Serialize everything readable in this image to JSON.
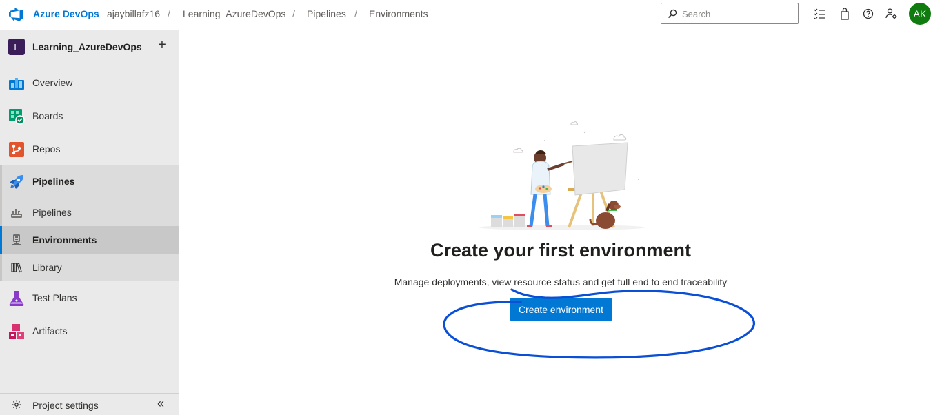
{
  "header": {
    "brand": "Azure DevOps",
    "org": "ajaybillafz16",
    "breadcrumb": [
      "Learning_AzureDevOps",
      "Pipelines",
      "Environments"
    ],
    "separator": "/",
    "search_placeholder": "Search",
    "avatar_initials": "AK",
    "avatar_color": "#107c10",
    "icons": [
      "task-list-icon",
      "shopping-bag-icon",
      "help-icon",
      "user-settings-icon"
    ]
  },
  "sidebar": {
    "project_initial": "L",
    "project_name": "Learning_AzureDevOps",
    "add_label": "+",
    "items": [
      {
        "label": "Overview",
        "icon": "overview-icon"
      },
      {
        "label": "Boards",
        "icon": "boards-icon"
      },
      {
        "label": "Repos",
        "icon": "repos-icon"
      },
      {
        "label": "Pipelines",
        "icon": "pipelines-icon"
      },
      {
        "label": "Test Plans",
        "icon": "test-plans-icon"
      },
      {
        "label": "Artifacts",
        "icon": "artifacts-icon"
      }
    ],
    "sub_items": [
      {
        "label": "Pipelines",
        "icon": "pipelines-sub-icon"
      },
      {
        "label": "Environments",
        "icon": "environments-icon",
        "selected": true
      },
      {
        "label": "Library",
        "icon": "library-icon"
      }
    ],
    "settings_label": "Project settings",
    "collapse_label": "«"
  },
  "main": {
    "title": "Create your first environment",
    "subtitle": "Manage deployments, view resource status and get full end to end traceability",
    "cta_label": "Create environment"
  },
  "colors": {
    "accent": "#0078d4",
    "annotation": "#0a4fd6"
  }
}
